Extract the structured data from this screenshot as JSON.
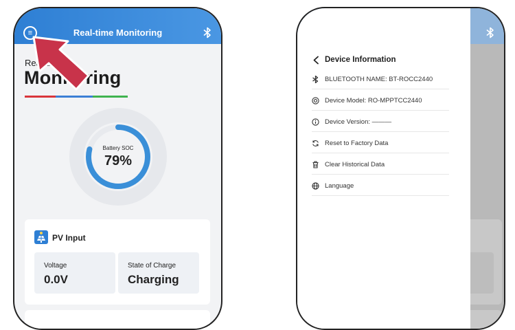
{
  "left_screen": {
    "header": {
      "title": "Real-time Monitoring"
    },
    "page": {
      "subtitle": "Real-time",
      "title": "Monitoring"
    },
    "gauge": {
      "label": "Battery SOC",
      "value_text": "79%",
      "level_percent": 79
    },
    "pv_card": {
      "title": "PV Input",
      "stats": [
        {
          "label": "Voltage",
          "value": "0.0V"
        },
        {
          "label": "State of Charge",
          "value": "Charging"
        }
      ]
    }
  },
  "right_screen": {
    "drawer": {
      "title": "Device Information",
      "items": [
        {
          "icon": "bluetooth-icon",
          "label": "BLUETOOTH NAME: BT-ROCC2440"
        },
        {
          "icon": "device-model-icon",
          "label": "Device Model: RO-MPPTCC2440"
        },
        {
          "icon": "info-icon",
          "label": "Device Version: ———"
        },
        {
          "icon": "reset-icon",
          "label": "Reset to Factory Data"
        },
        {
          "icon": "trash-icon",
          "label": "Clear Historical Data"
        },
        {
          "icon": "globe-icon",
          "label": "Language"
        }
      ]
    }
  },
  "colors": {
    "header_blue": "#2e7fd4",
    "accent_red": "#d9353b",
    "accent_green": "#3fb34f",
    "arrow_red": "#c8334a"
  }
}
